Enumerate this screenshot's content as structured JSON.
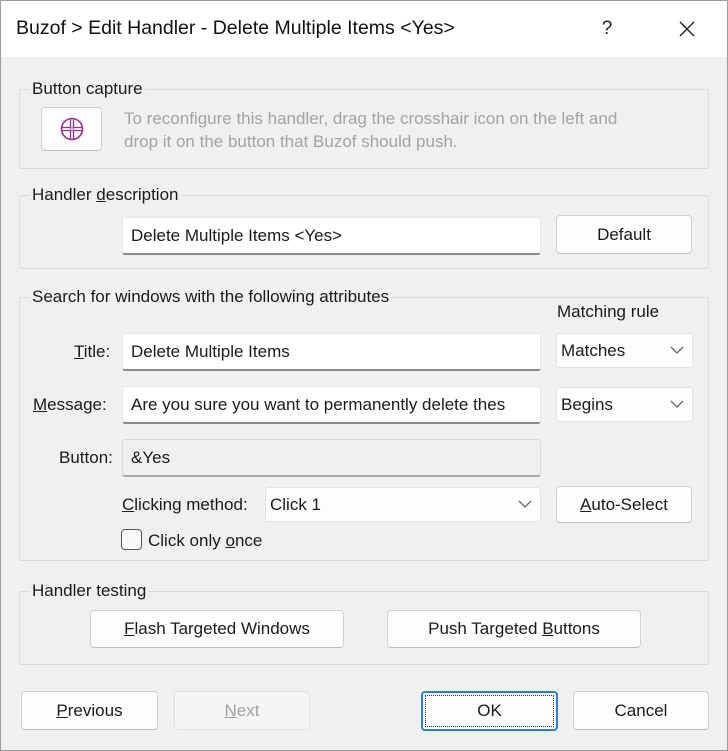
{
  "window": {
    "title": "Buzof > Edit Handler - Delete Multiple Items <Yes>",
    "help_label": "?",
    "close_icon": "close-icon"
  },
  "button_capture": {
    "group_label": "Button capture",
    "crosshair_icon": "crosshair-icon",
    "hint_line1": "To reconfigure this handler, drag the crosshair icon on the left and",
    "hint_line2": "drop it on the button that Buzof should push.",
    "accent_color": "#9b2d9b"
  },
  "handler_description": {
    "group_label_pre": "Handler ",
    "group_label_accel": "d",
    "group_label_post": "escription",
    "value": "Delete Multiple Items <Yes>",
    "default_button": "Default"
  },
  "search": {
    "group_label": "Search for windows with the following attributes",
    "matching_rule_label": "Matching rule",
    "title_label_accel": "T",
    "title_label_rest": "itle:",
    "title_value": "Delete Multiple Items",
    "title_rule": "Matches",
    "message_label_accel": "M",
    "message_label_rest": "essage:",
    "message_value": "Are you sure you want to permanently delete thes",
    "message_rule": "Begins",
    "button_label": "Button:",
    "button_value": "&Yes",
    "clicking_method_label_accel": "C",
    "clicking_method_label_rest": "licking method:",
    "clicking_method_value": "Click 1",
    "auto_select_accel": "A",
    "auto_select_rest": "uto-Select",
    "click_once_pre": "Click only ",
    "click_once_accel": "o",
    "click_once_post": "nce",
    "click_once_checked": false
  },
  "testing": {
    "group_label": "Handler testing",
    "flash_accel": "F",
    "flash_rest": "lash Targeted Windows",
    "push_pre": "Push Targeted ",
    "push_accel": "B",
    "push_post": "uttons"
  },
  "footer": {
    "previous_accel": "P",
    "previous_rest": "revious",
    "next_accel": "N",
    "next_rest": "ext",
    "next_disabled": true,
    "ok": "OK",
    "cancel": "Cancel"
  }
}
